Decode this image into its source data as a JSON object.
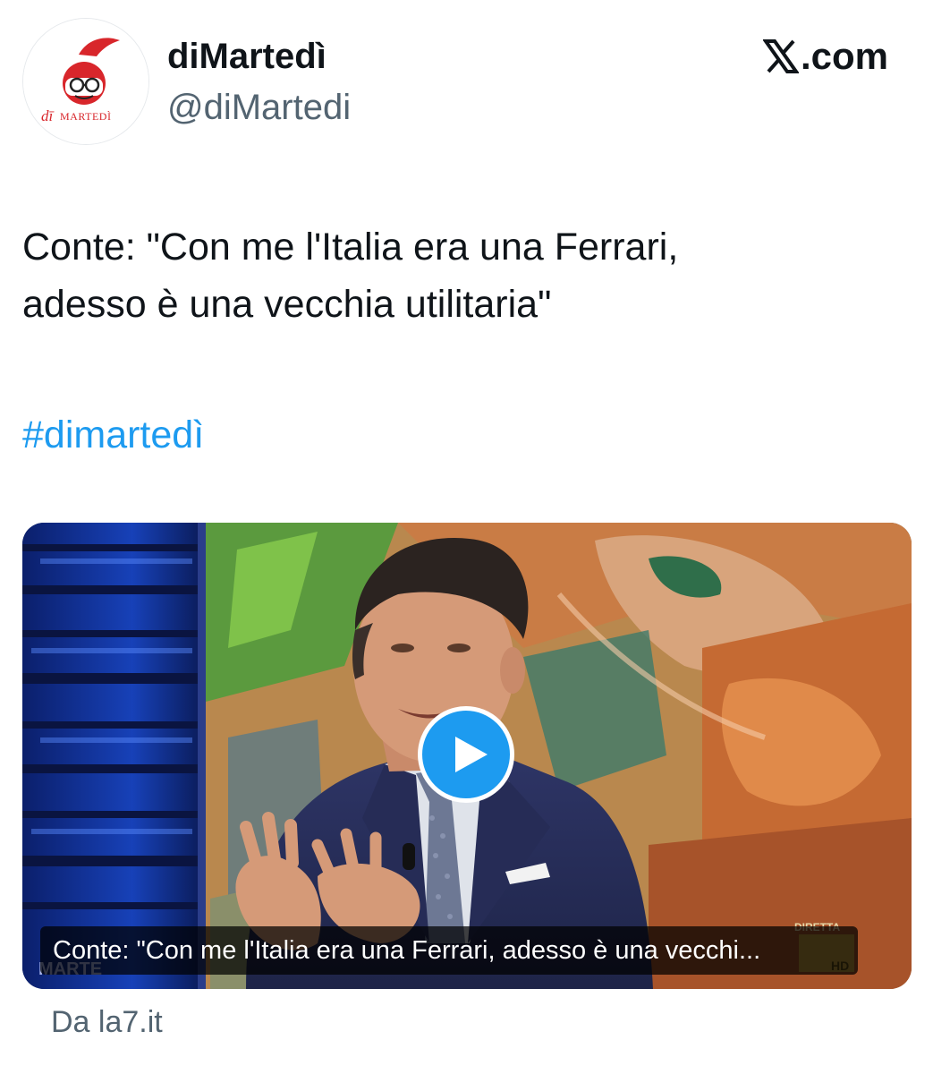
{
  "author": {
    "display_name": "diMartedì",
    "handle": "@diMartedi",
    "avatar_logo": "dī MARTEDÌ"
  },
  "brand": {
    "label": ".com",
    "icon": "x-logo-icon"
  },
  "tweet": {
    "text_line_1": "Conte: \"Con me l'Italia era una Ferrari,",
    "text_line_2": "adesso è una vecchia utilitaria\"",
    "hashtag": "#dimartedì"
  },
  "media": {
    "caption": "Conte: \"Con me l'Italia era una Ferrari, adesso è una vecchi...",
    "play_icon": "play-icon",
    "overlay_badge": "DIRETTA",
    "overlay_badge_2": "HD",
    "overlay_logo": "MARTE"
  },
  "source": {
    "label": "Da la7.it"
  },
  "colors": {
    "hashtag": "#1d9bf0",
    "play_button": "#1d9bf0",
    "handle": "#536471",
    "text": "#0f1419"
  }
}
